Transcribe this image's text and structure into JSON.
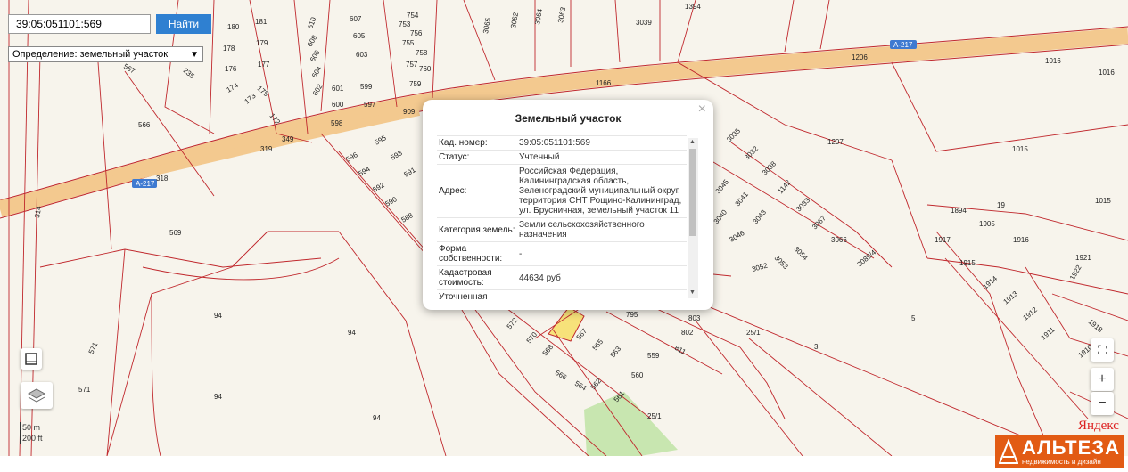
{
  "search": {
    "value": "39:05:051101:569",
    "button_label": "Найти"
  },
  "definition_select": {
    "value": "Определение: земельный участок"
  },
  "popup": {
    "title": "Земельный участок",
    "close": "×",
    "rows": [
      {
        "key": "Кад. номер:",
        "value": "39:05:051101:569"
      },
      {
        "key": "Статус:",
        "value": "Учтенный"
      },
      {
        "key": "Адрес:",
        "value": "Российская Федерация, Калининградская область, Зеленоградский муниципальный округ, территория СНТ Рощино-Калининград, ул. Брусничная, земельный участок 11"
      },
      {
        "key": "Категория земель:",
        "value": "Земли сельскохозяйственного назначения"
      },
      {
        "key": "Форма собственности:",
        "value": "-"
      },
      {
        "key": "Кадастровая стоимость:",
        "value": "44634 руб"
      },
      {
        "key": "Уточненная",
        "value": ""
      }
    ]
  },
  "roads": {
    "a217_left": "A-217",
    "a217_right": "A-217",
    "a217_mid": "A-217"
  },
  "map_labels": {
    "p566": "566",
    "p569": "569",
    "p94a": "94",
    "p94b": "94",
    "p94c": "94",
    "p94d": "94",
    "p571a": "571",
    "p571b": "571",
    "p314": "314",
    "p318": "318",
    "p319": "319",
    "p349": "349",
    "p909": "909",
    "p1166": "1166",
    "p1206": "1206",
    "p1016a": "1016",
    "p1016b": "1016",
    "p1207": "1207",
    "p1015a": "1015",
    "p1015b": "1015",
    "p3039": "3039",
    "p5": "5",
    "p3": "3",
    "p25_1a": "25/1",
    "p25_1b": "25/1",
    "p1394": "1394",
    "p180": "180",
    "p181": "181",
    "p178": "178",
    "p179": "179",
    "p176": "176",
    "p177": "177",
    "p174": "174",
    "p175": "175",
    "p173": "173",
    "p172": "172",
    "p235": "235",
    "p567": "567",
    "p610": "610",
    "p607": "607",
    "p605": "605",
    "p603": "603",
    "p608": "608",
    "p606": "606",
    "p604": "604",
    "p602": "602",
    "p601": "601",
    "p599": "599",
    "p600": "600",
    "p597": "597",
    "p598": "598",
    "p753": "753",
    "p754": "754",
    "p755": "755",
    "p756": "756",
    "p757": "757",
    "p758": "758",
    "p759": "759",
    "p760": "760",
    "p3065": "3065",
    "p3062": "3062",
    "p3064": "3064",
    "p3063": "3063",
    "p596": "596",
    "p595": "595",
    "p594": "594",
    "p593": "593",
    "p592": "592",
    "p591": "591",
    "p590": "590",
    "p588": "588",
    "p3035": "3035",
    "p3032": "3032",
    "p3038": "3038",
    "p3045": "3045",
    "p3041": "3041",
    "p1142": "1142",
    "p3040": "3040",
    "p3043": "3043",
    "p3033": "3033",
    "p3046": "3046",
    "p3067": "3067",
    "p3054": "3054",
    "p3053": "3053",
    "p3066": "3066",
    "p3052": "3052",
    "p3089_4": "3089/4",
    "p1894": "1894",
    "p19": "19",
    "p1905": "1905",
    "p1917": "1917",
    "p1916": "1916",
    "p1915": "1915",
    "p1921": "1921",
    "p1914": "1914",
    "p1922": "1922",
    "p1913": "1913",
    "p1912": "1912",
    "p1911": "1911",
    "p1910": "1910",
    "p1918": "1918",
    "p795": "795",
    "p803": "803",
    "p802": "802",
    "p572": "572",
    "p570": "570",
    "p568": "568",
    "p567b": "567",
    "p565": "565",
    "p563": "563",
    "p559": "559",
    "p566b": "566",
    "p564": "564",
    "p562": "562",
    "p560": "560",
    "p561": "561",
    "p811": "811"
  },
  "controls": {
    "zoom_in": "+",
    "zoom_out": "−",
    "fullscreen": "⛶"
  },
  "scale": {
    "m": "50 m",
    "ft": "200 ft"
  },
  "yandex": "Яндекс",
  "brand": {
    "name": "АЛЬТЕЗА",
    "tagline": "недвижимость и дизайн"
  },
  "colors": {
    "parcel_line": "#c0282d",
    "road_fill": "#f3c98f",
    "road_label_bg": "#3e7ad1",
    "button": "#2f80d1",
    "brand": "#e25b14",
    "highlight": "#f7e27a",
    "green": "#c8e6b0"
  }
}
